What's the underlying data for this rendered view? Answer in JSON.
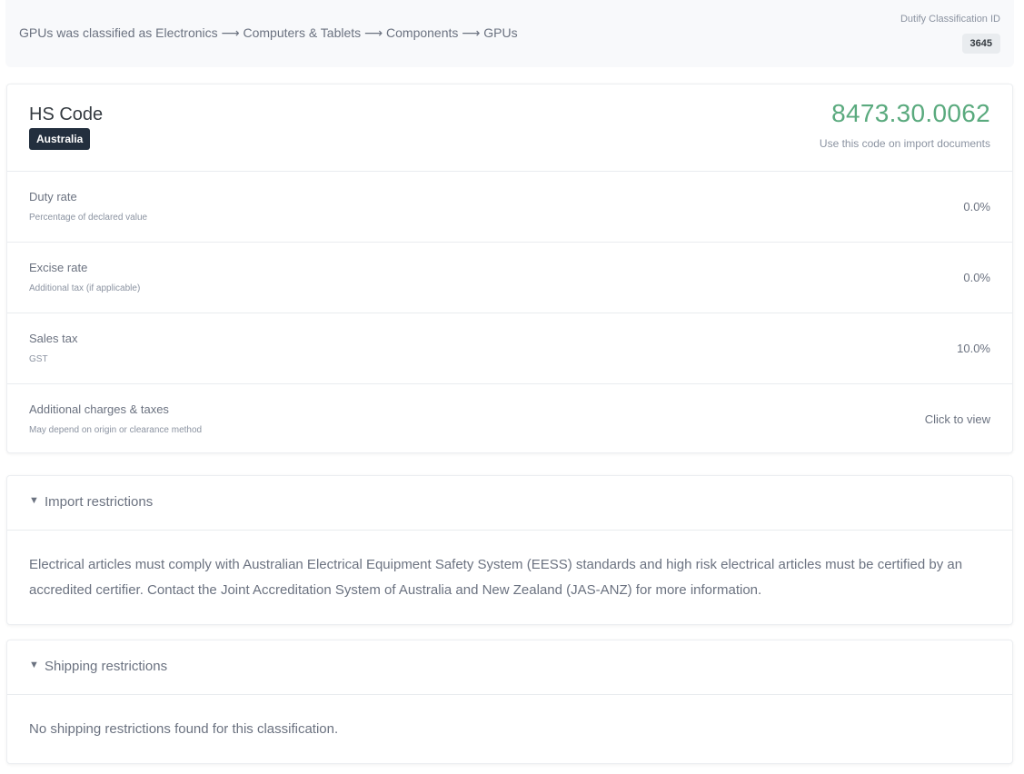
{
  "banner": {
    "classification_text": "GPUs was classified as Electronics ⟶ Computers & Tablets ⟶ Components ⟶ GPUs",
    "classification_id_label": "Dutify Classification ID",
    "classification_id": "3645"
  },
  "hs": {
    "title": "HS Code",
    "country": "Australia",
    "code": "8473.30.0062",
    "note": "Use this code on import documents"
  },
  "rates": [
    {
      "label": "Duty rate",
      "sub": "Percentage of declared value",
      "value": "0.0%"
    },
    {
      "label": "Excise rate",
      "sub": "Additional tax (if applicable)",
      "value": "0.0%"
    },
    {
      "label": "Sales tax",
      "sub": "GST",
      "value": "10.0%"
    },
    {
      "label": "Additional charges & taxes",
      "sub": "May depend on origin or clearance method",
      "value": "Click to view"
    }
  ],
  "import_restrictions": {
    "toggle_icon": "triangle-down",
    "title": "Import restrictions",
    "body": "Electrical articles must comply with Australian Electrical Equipment Safety System (EESS) standards and high risk electrical articles must be certified by an accredited certifier. Contact the Joint Accreditation System of Australia and New Zealand (JAS-ANZ) for more information."
  },
  "shipping_restrictions": {
    "toggle_icon": "triangle-down",
    "title": "Shipping restrictions",
    "body": "No shipping restrictions found for this classification."
  },
  "colors": {
    "hs_code": "#5aaa7e",
    "badge_bg": "#232f3e"
  }
}
